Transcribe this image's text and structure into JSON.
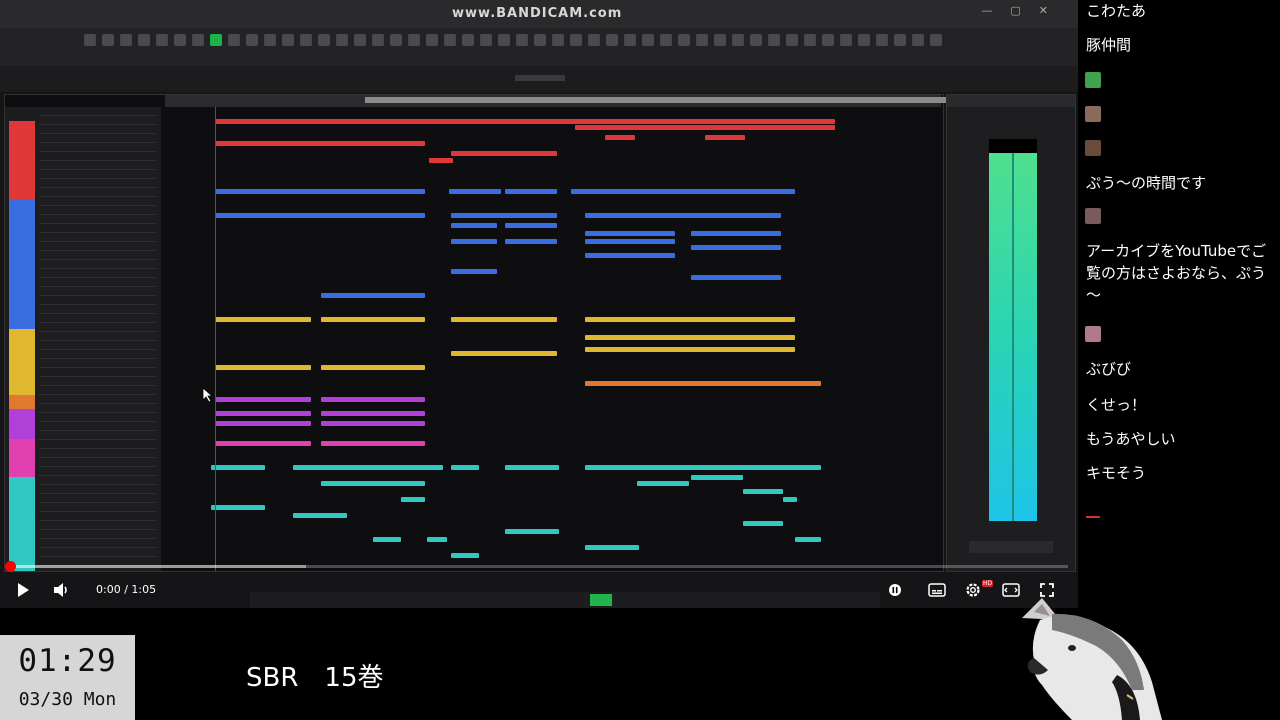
{
  "video": {
    "watermark": "www.BANDICAM.com",
    "current_time": "0:00",
    "duration": "1:05",
    "progress_fraction": 0.0,
    "buffered_fraction": 0.28,
    "controls": {
      "play_icon": "play-icon",
      "volume_icon": "volume-icon",
      "autoplay_icon": "pause-toggle-icon",
      "subtitles_icon": "subtitles-icon",
      "settings_icon": "gear-icon",
      "settings_badge": "HD",
      "theater_icon": "theater-icon",
      "fullscreen_icon": "fullscreen-icon"
    },
    "accent_color": "#ff0000"
  },
  "chat": {
    "messages": [
      {
        "type": "text",
        "text": "こわたあ"
      },
      {
        "type": "text",
        "text": "豚仲間"
      },
      {
        "type": "avatar",
        "color": "#3fa34d"
      },
      {
        "type": "avatar",
        "color": "#8a6a5a"
      },
      {
        "type": "avatar",
        "color": "#6a4a3a"
      },
      {
        "type": "text",
        "text": "ぷう～の時間です"
      },
      {
        "type": "avatar",
        "color": "#7a5a5a"
      },
      {
        "type": "text",
        "text": "アーカイブをYouTubeでご覧の方はさよおなら、ぷう～"
      },
      {
        "type": "avatar",
        "color": "#b07a8a"
      },
      {
        "type": "text",
        "text": "ぶびび"
      },
      {
        "type": "text",
        "text": "くせっ！"
      },
      {
        "type": "text",
        "text": "もうあやしい"
      },
      {
        "type": "text",
        "text": "キモそう"
      }
    ]
  },
  "clock": {
    "time": "01:29",
    "date": "03/30 Mon"
  },
  "caption": "SBR　15巻",
  "daw": {
    "track_colors": [
      "#e03838",
      "#3a6ee0",
      "#e0b830",
      "#e07830",
      "#b040d8",
      "#e040b0",
      "#30c8c0"
    ],
    "meter_color_top": "#4fe08e",
    "meter_color_bottom": "#1ec4e8"
  }
}
